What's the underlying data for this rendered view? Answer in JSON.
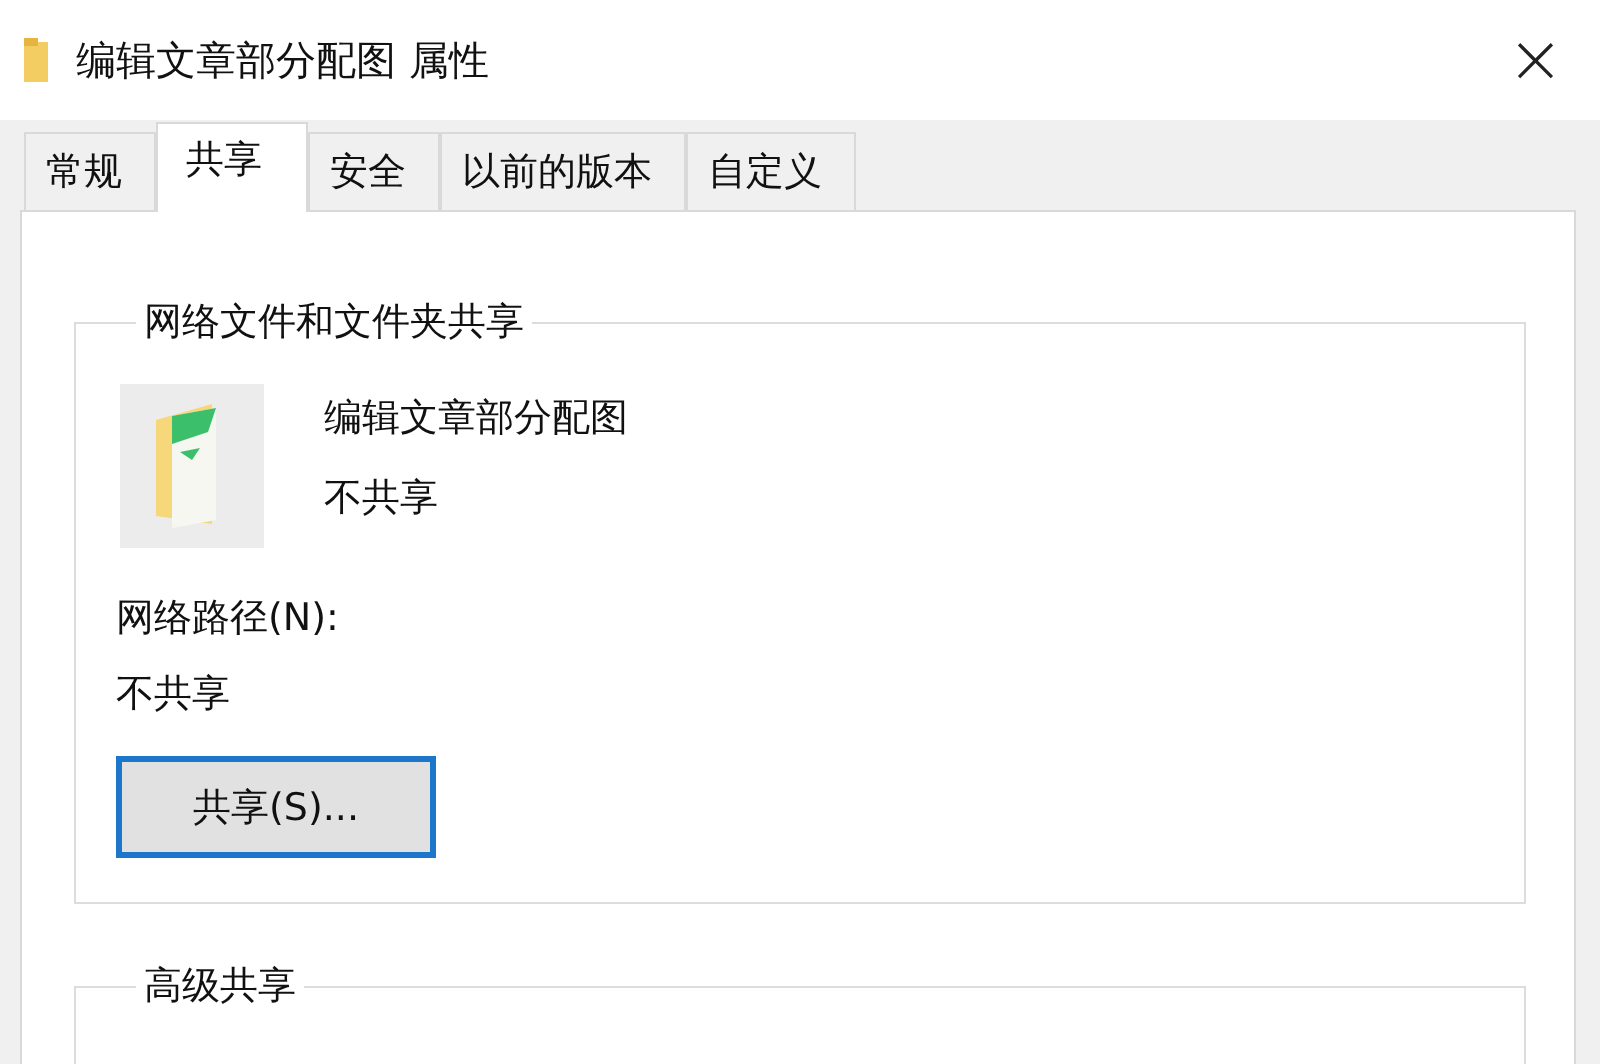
{
  "window": {
    "title": "编辑文章部分配图 属性",
    "close": "×"
  },
  "tabs": [
    {
      "label": "常规",
      "selected": false
    },
    {
      "label": "共享",
      "selected": true
    },
    {
      "label": "安全",
      "selected": false
    },
    {
      "label": "以前的版本",
      "selected": false
    },
    {
      "label": "自定义",
      "selected": false
    }
  ],
  "network_sharing": {
    "legend": "网络文件和文件夹共享",
    "name": "编辑文章部分配图",
    "status": "不共享",
    "path_label": "网络路径(N):",
    "path_value": "不共享",
    "share_button": "共享(S)..."
  },
  "advanced_sharing": {
    "legend": "高级共享"
  }
}
